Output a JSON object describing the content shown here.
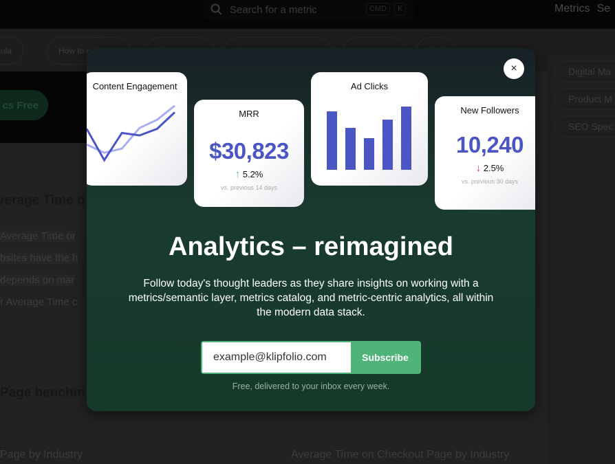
{
  "topnav": {
    "search_placeholder": "Search for a metric",
    "kbd": [
      "CMD",
      "K"
    ],
    "links": [
      "Metrics",
      "Se"
    ]
  },
  "chips": [
    "rmula",
    "How to calculate",
    "Benchmarks",
    "Visualization examples",
    "Look at the",
    "FAQ"
  ],
  "hero": {
    "button": "cs Free"
  },
  "background": {
    "heading1": "verage Time o",
    "lines": [
      " Average Time or",
      "bsites have the h",
      " depends on mar",
      "r Average Time c"
    ],
    "heading2": "Page benchm",
    "caption_left": "Page by Industry",
    "caption_right": "Average Time on Checkout Page by Industry"
  },
  "sidebar": {
    "items": [
      "Digital Ma",
      "Product M",
      "SEO Spec"
    ]
  },
  "modal": {
    "close_label": "×",
    "cards": {
      "content_engagement": {
        "title": "Content Engagement",
        "series_dark": [
          48,
          10,
          43,
          40,
          48,
          68
        ],
        "series_light": [
          29,
          19,
          24,
          49,
          59,
          76
        ]
      },
      "mrr": {
        "title": "MRR",
        "value": "$30,823",
        "change": "5.2%",
        "direction": "up",
        "subtitle": "vs. previous 14 days"
      },
      "ad_clicks": {
        "title": "Ad Clicks",
        "bars": [
          85,
          61,
          46,
          73,
          92
        ]
      },
      "new_followers": {
        "title": "New Followers",
        "value": "10,240",
        "change": "2.5%",
        "direction": "down",
        "subtitle": "vs. previous 30 days"
      }
    },
    "headline": "Analytics – reimagined",
    "description": "Follow today's thought leaders as they share insights on working with a metrics/semantic layer, metrics catalog, and metric-centric analytics, all within the modern data stack.",
    "email_value": "example@klipfolio.com",
    "subscribe_label": "Subscribe",
    "note": "Free, delivered to your inbox every week."
  },
  "colors": {
    "accent": "#4b56c4",
    "accent_light": "#a9aef2",
    "green": "#4fb37a",
    "up": "#4fc187",
    "down": "#e0334a"
  }
}
